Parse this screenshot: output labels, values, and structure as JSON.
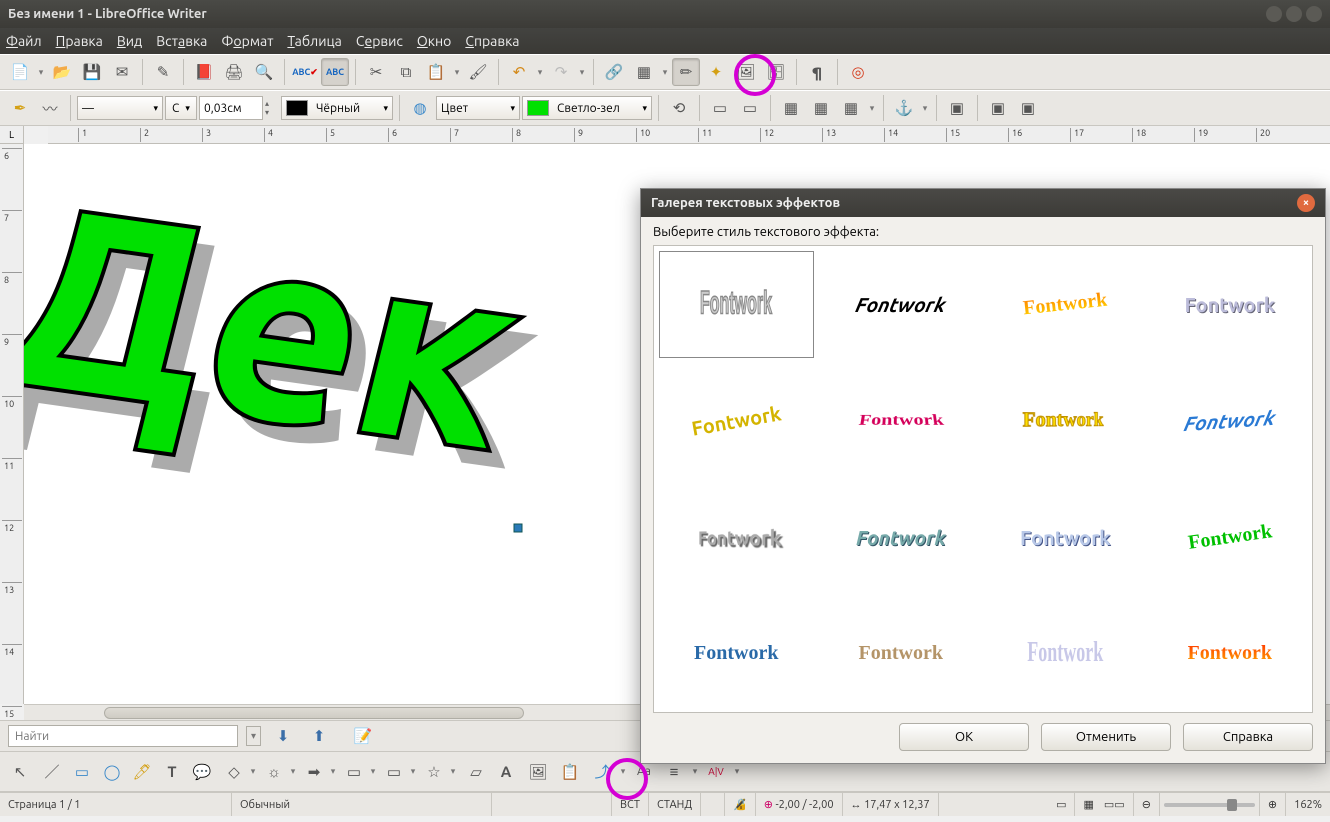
{
  "window": {
    "title": "Без имени 1 - LibreOffice Writer"
  },
  "menu": {
    "file": "Файл",
    "edit": "Правка",
    "view": "Вид",
    "insert": "Вставка",
    "format": "Формат",
    "table": "Таблица",
    "service": "Сервис",
    "window": "Окно",
    "help": "Справка"
  },
  "tb2": {
    "line_width": "0,03см",
    "line_color_label": "Чёрный",
    "fill_label": "Цвет",
    "fill_color_label": "Светло-зел",
    "cap_label": "C"
  },
  "ruler": {
    "units_h": [
      "1",
      "2",
      "3",
      "4",
      "5",
      "6",
      "7",
      "8",
      "9",
      "10",
      "11",
      "12",
      "13",
      "14",
      "15",
      "16",
      "17",
      "18",
      "19",
      "20"
    ],
    "units_v": [
      "6",
      "7",
      "8",
      "9",
      "10",
      "11",
      "12",
      "13",
      "14",
      "15"
    ]
  },
  "canvas": {
    "text": "Дек"
  },
  "find": {
    "placeholder": "Найти"
  },
  "dialog": {
    "title": "Галерея текстовых эффектов",
    "label": "Выберите стиль текстового эффекта:",
    "sample": "Fontwork",
    "buttons": {
      "ok": "OK",
      "cancel": "Отменить",
      "help": "Справка"
    }
  },
  "status": {
    "page": "Страница 1 / 1",
    "style": "Обычный",
    "insert": "ВСТ",
    "mode": "СТАНД",
    "pos": "-2,00 / -2,00",
    "size": "17,47 x 12,37",
    "zoom": "162%"
  }
}
